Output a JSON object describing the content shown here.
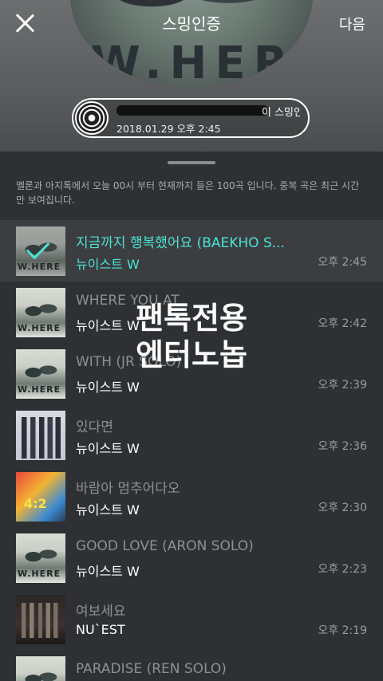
{
  "header": {
    "title": "스밍인증",
    "next_label": "다음",
    "album_logo": "W.HERE",
    "certificate": {
      "line1_suffix": "이 스밍인증",
      "line2": "2018.01.29 오후 2:45"
    }
  },
  "info_text": "멜론과 아지톡에서 오늘 00시 부터 현재까지 들은 100곡 입니다. 중복 곡은 최근 시간만 보여집니다.",
  "songs": [
    {
      "title": "지금까지 행복했어요 (BAEKHO S...",
      "artist": "뉴이스트 W",
      "time": "오후 2:45",
      "selected": true,
      "cover": "where"
    },
    {
      "title": "WHERE YOU AT",
      "artist": "뉴이스트 W",
      "time": "오후 2:42",
      "selected": false,
      "cover": "where"
    },
    {
      "title": "WITH (JR SOLO)",
      "artist": "뉴이스트 W",
      "time": "오후 2:39",
      "selected": false,
      "cover": "where"
    },
    {
      "title": "있다면",
      "artist": "뉴이스트 W",
      "time": "오후 2:36",
      "selected": false,
      "cover": "group"
    },
    {
      "title": "바람아 멈추어다오",
      "artist": "뉴이스트 W",
      "time": "오후 2:30",
      "selected": false,
      "cover": "colorful"
    },
    {
      "title": "GOOD LOVE (ARON SOLO)",
      "artist": "뉴이스트 W",
      "time": "오후 2:23",
      "selected": false,
      "cover": "where"
    },
    {
      "title": "여보세요",
      "artist": "NU`EST",
      "time": "오후 2:19",
      "selected": false,
      "cover": "dark"
    },
    {
      "title": "PARADISE (REN SOLO)",
      "artist": "",
      "time": "",
      "selected": false,
      "cover": "where"
    }
  ],
  "watermark": {
    "line1": "팬톡전용",
    "line2": "엔터노놉"
  },
  "colors": {
    "accent": "#4de3d4",
    "background": "#2e3033"
  }
}
